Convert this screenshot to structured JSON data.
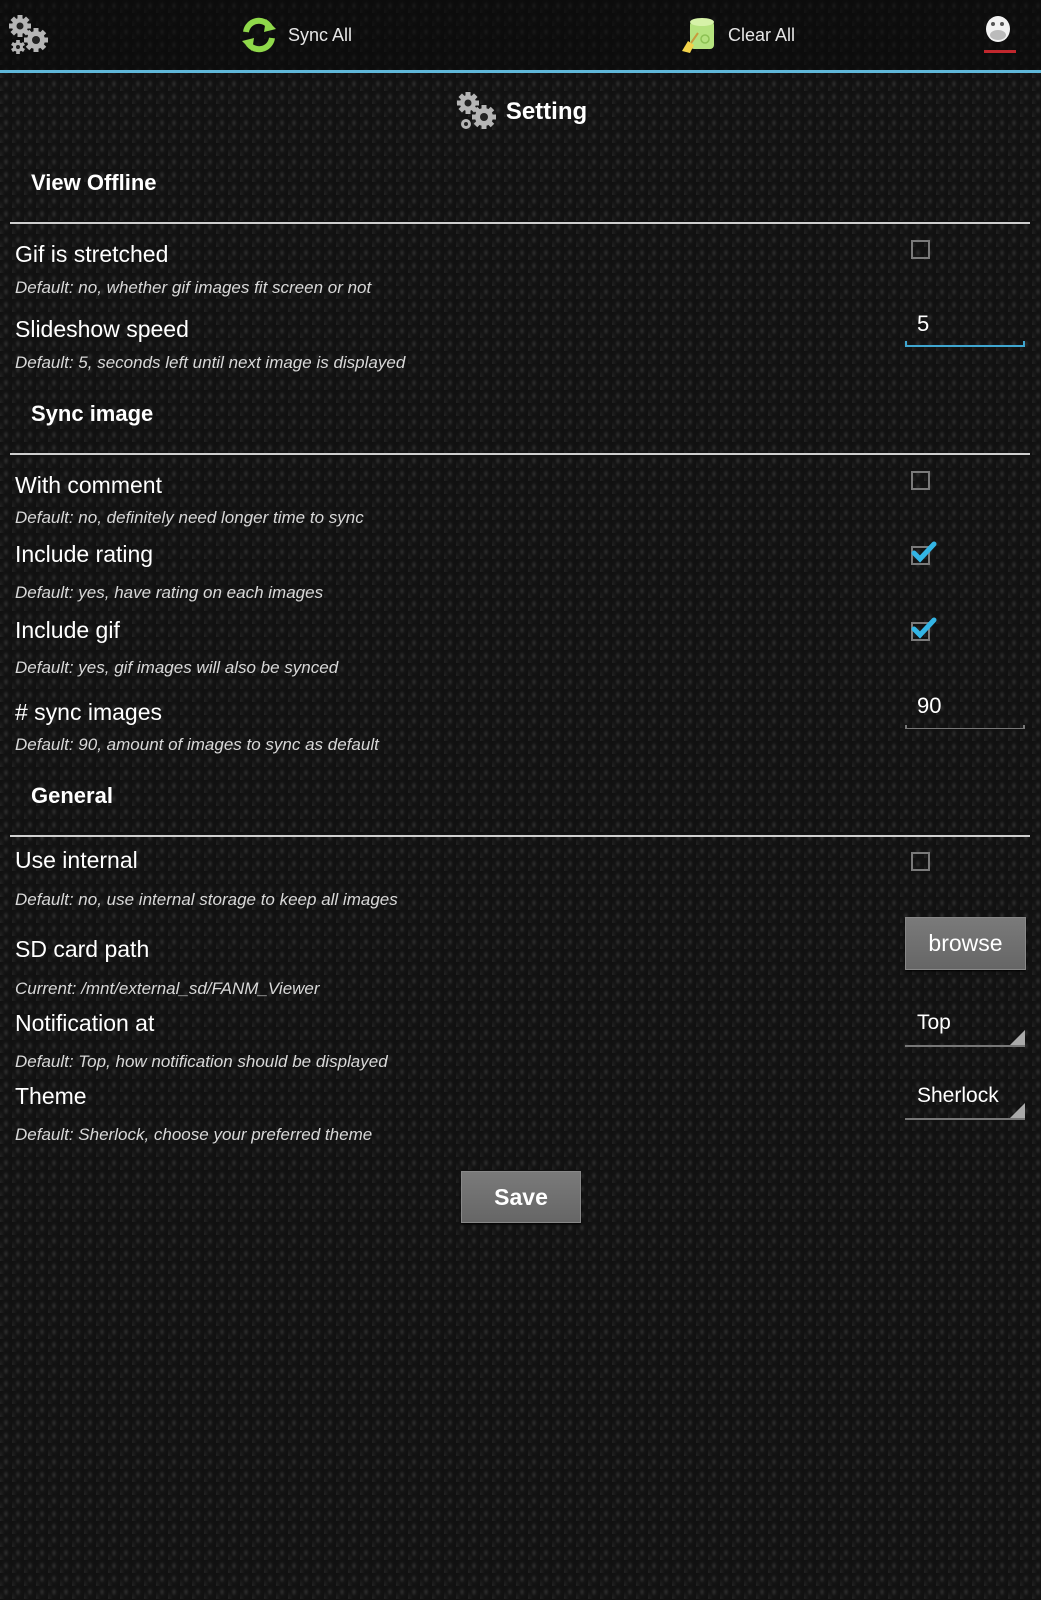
{
  "actionbar": {
    "settings_icon": "gears-icon",
    "sync_all_label": "Sync All",
    "clear_all_label": "Clear All",
    "profile_icon": "forever-alone-meme-icon",
    "accent_color": "#5fb7d8"
  },
  "page": {
    "title": "Setting",
    "title_icon": "gears-icon"
  },
  "sections": [
    {
      "title": "View Offline",
      "prefs": [
        {
          "title": "Gif is stretched",
          "desc": "Default: no, whether gif images fit screen or not",
          "control": "checkbox",
          "checked": false
        },
        {
          "title": "Slideshow speed",
          "desc": "Default: 5, seconds left until next image is displayed",
          "control": "text",
          "value": "5",
          "focused": true
        }
      ]
    },
    {
      "title": "Sync image",
      "prefs": [
        {
          "title": "With comment",
          "desc": "Default: no, definitely need longer time to sync",
          "control": "checkbox",
          "checked": false
        },
        {
          "title": "Include rating",
          "desc": "Default: yes, have rating on each images",
          "control": "checkbox",
          "checked": true
        },
        {
          "title": "Include gif",
          "desc": "Default: yes, gif images will also be synced",
          "control": "checkbox",
          "checked": true
        },
        {
          "title": "# sync images",
          "desc": "Default: 90, amount of images to sync as default",
          "control": "text",
          "value": "90",
          "focused": false
        }
      ]
    },
    {
      "title": "General",
      "prefs": [
        {
          "title": "Use internal",
          "desc": "Default: no, use internal storage to keep all images",
          "control": "checkbox",
          "checked": false
        },
        {
          "title": "SD card path",
          "desc": "Current: /mnt/external_sd/FANM_Viewer",
          "control": "button",
          "button_label": "browse"
        },
        {
          "title": "Notification at",
          "desc": "Default: Top, how notification should be displayed",
          "control": "spinner",
          "value": "Top"
        },
        {
          "title": "Theme",
          "desc": "Default: Sherlock, choose your preferred theme",
          "control": "spinner",
          "value": "Sherlock"
        }
      ]
    }
  ],
  "save_label": "Save",
  "colors": {
    "check": "#33b5e5",
    "focus_underline": "#3fa6d0"
  }
}
